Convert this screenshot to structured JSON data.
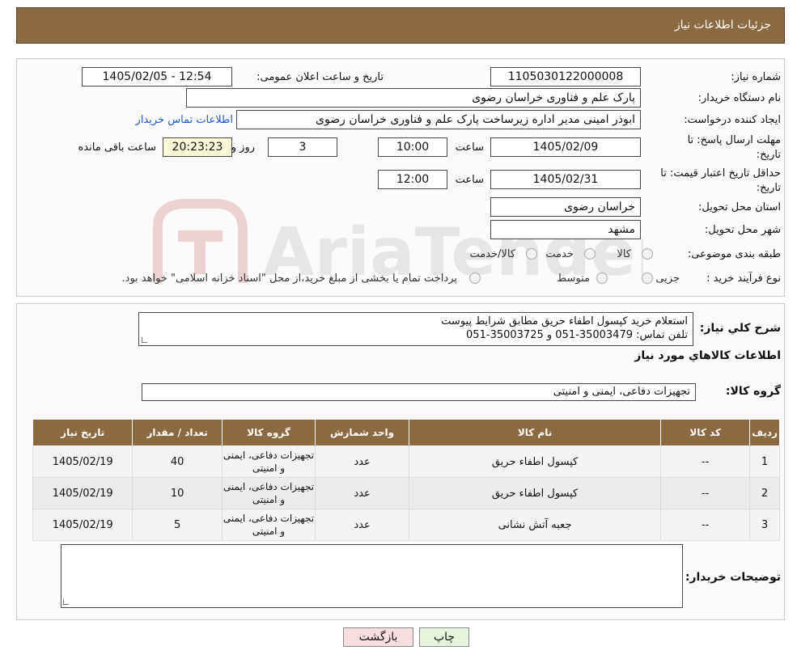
{
  "header": {
    "title": "جزئیات اطلاعات نیاز"
  },
  "form": {
    "need_number_label": "شماره نیاز:",
    "need_number": "1105030122000008",
    "announce_label": "تاریخ و ساعت اعلان عمومی:",
    "announce_value": "1405/02/05 - 12:54",
    "buyer_org_label": "نام دستگاه خریدار:",
    "buyer_org": "پارک علم و فناوری خراسان رضوی",
    "creator_label": "ایجاد کننده درخواست:",
    "creator": "ابوذر امینی مدیر اداره زیرساخت پارک علم و فناوری خراسان رضوی",
    "contact_link": "اطلاعات تماس خریدار",
    "deadline_label_1": "مهلت ارسال پاسخ: تا",
    "deadline_label_2": "تاریخ:",
    "deadline_date": "1405/02/09",
    "time_label": "ساعت",
    "deadline_time": "10:00",
    "days_value": "3",
    "days_label": "روز و",
    "remaining_time": "20:23:23",
    "remaining_label": "ساعت باقی مانده",
    "validity_label_1": "حداقل تاریخ اعتبار قیمت: تا",
    "validity_label_2": "تاریخ:",
    "validity_date": "1405/02/31",
    "validity_time": "12:00",
    "province_label": "استان محل تحویل:",
    "province": "خراسان رضوی",
    "city_label": "شهر محل تحویل:",
    "city": "مشهد",
    "category_label": "طبقه بندی موضوعی:",
    "category_options": [
      "کالا",
      "خدمت",
      "کالا/خدمت"
    ],
    "process_label": "نوع فرآیند خرید :",
    "process_options": [
      "جزیی",
      "متوسط"
    ],
    "process_note": "پرداخت تمام یا بخشی از مبلغ خرید،از محل \"اسناد خزانه اسلامی\" خواهد بود."
  },
  "details": {
    "description_label": "شرح کلي نياز:",
    "description_line1": "استعلام خرید کپسول اطفاء حریق مطابق شرایط پیوست",
    "description_line2": "تلفن تماس: 35003479-051 و 35003725-051",
    "goods_info_title": "اطلاعات کالاهاي مورد نياز",
    "goods_group_label": "گروه کالا:",
    "goods_group": "تجهیزات دفاعی، ایمنی و امنیتی",
    "table": {
      "headers": [
        "رديف",
        "کد کالا",
        "نام کالا",
        "واحد شمارش",
        "گروه کالا",
        "تعداد / مقدار",
        "تاریخ نیاز"
      ],
      "rows": [
        [
          "1",
          "--",
          "کپسول اطفاء حریق",
          "عدد",
          "تجهیزات دفاعی، ایمنی و امنیتی",
          "40",
          "1405/02/19"
        ],
        [
          "2",
          "--",
          "کپسول اطفاء حریق",
          "عدد",
          "تجهیزات دفاعی، ایمنی و امنیتی",
          "10",
          "1405/02/19"
        ],
        [
          "3",
          "--",
          "جعبه آتش نشانی",
          "عدد",
          "تجهیزات دفاعی، ایمنی و امنیتی",
          "5",
          "1405/02/19"
        ]
      ]
    },
    "buyer_notes_label": "توضیحات خریدار:",
    "buyer_notes": ""
  },
  "buttons": {
    "print": "چاپ",
    "back": "بازگشت"
  },
  "watermark": "AriaTender.neT",
  "colors": {
    "header_bg": "#8b6a42",
    "back_button_bg": "#f8dede",
    "print_button_bg": "#e6f6dc",
    "remaining_bg": "#fbf8d8"
  }
}
